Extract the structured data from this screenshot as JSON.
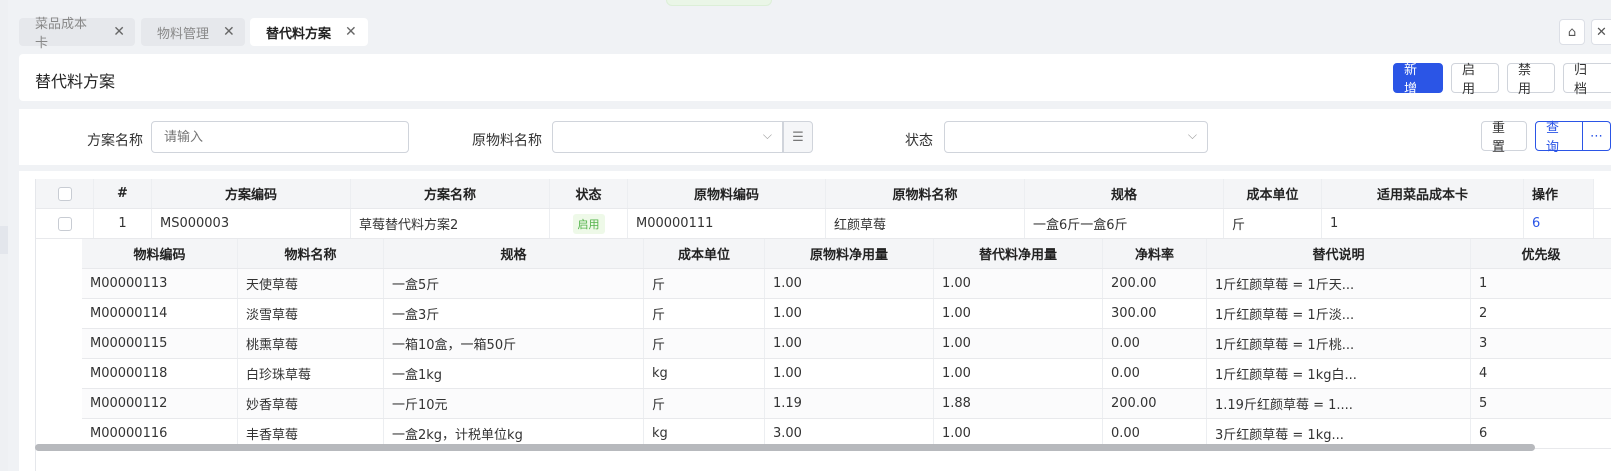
{
  "tabs": [
    {
      "label": "菜品成本卡",
      "active": false
    },
    {
      "label": "物料管理",
      "active": false
    },
    {
      "label": "替代料方案",
      "active": true
    }
  ],
  "header": {
    "title": "替代料方案",
    "buttons": {
      "add": "新增",
      "enable": "启用",
      "disable": "禁用",
      "archive": "归档"
    }
  },
  "filter": {
    "plan_name_label": "方案名称",
    "plan_name_placeholder": "请输入",
    "material_name_label": "原物料名称",
    "status_label": "状态",
    "reset": "重置",
    "query": "查询",
    "more": "⋯"
  },
  "main_table": {
    "columns": [
      "#",
      "方案编码",
      "方案名称",
      "状态",
      "原物料编码",
      "原物料名称",
      "规格",
      "成本单位",
      "适用菜品成本卡",
      "操作"
    ],
    "rows": [
      {
        "index": "1",
        "code": "MS000003",
        "name": "草莓替代料方案2",
        "status": "启用",
        "material_code": "M00000111",
        "material_name": "红颜草莓",
        "spec": "一盒6斤一盒6斤",
        "unit": "斤",
        "dish_cards": "1",
        "op": "6"
      }
    ]
  },
  "sub_table": {
    "columns": [
      "物料编码",
      "物料名称",
      "规格",
      "成本单位",
      "原物料净用量",
      "替代料净用量",
      "净料率",
      "替代说明",
      "优先级"
    ],
    "rows": [
      [
        "M00000113",
        "天使草莓",
        "一盒5斤",
        "斤",
        "1.00",
        "1.00",
        "200.00",
        "1斤红颜草莓 = 1斤天...",
        "1"
      ],
      [
        "M00000114",
        "淡雪草莓",
        "一盒3斤",
        "斤",
        "1.00",
        "1.00",
        "300.00",
        "1斤红颜草莓 = 1斤淡...",
        "2"
      ],
      [
        "M00000115",
        "桃熏草莓",
        "一箱10盒，一箱50斤",
        "斤",
        "1.00",
        "1.00",
        "0.00",
        "1斤红颜草莓 = 1斤桃...",
        "3"
      ],
      [
        "M00000118",
        "白珍珠草莓",
        "一盒1kg",
        "kg",
        "1.00",
        "1.00",
        "0.00",
        "1斤红颜草莓 = 1kg白...",
        "4"
      ],
      [
        "M00000112",
        "妙香草莓",
        "一斤10元",
        "斤",
        "1.19",
        "1.88",
        "200.00",
        "1.19斤红颜草莓 = 1....",
        "5"
      ],
      [
        "M00000116",
        "丰香草莓",
        "一盒2kg，计税单位kg",
        "kg",
        "3.00",
        "1.00",
        "0.00",
        "3斤红颜草莓 = 1kg...",
        "6"
      ]
    ]
  },
  "colors": {
    "primary": "#2b55e6",
    "status_green": "#52b34a"
  }
}
